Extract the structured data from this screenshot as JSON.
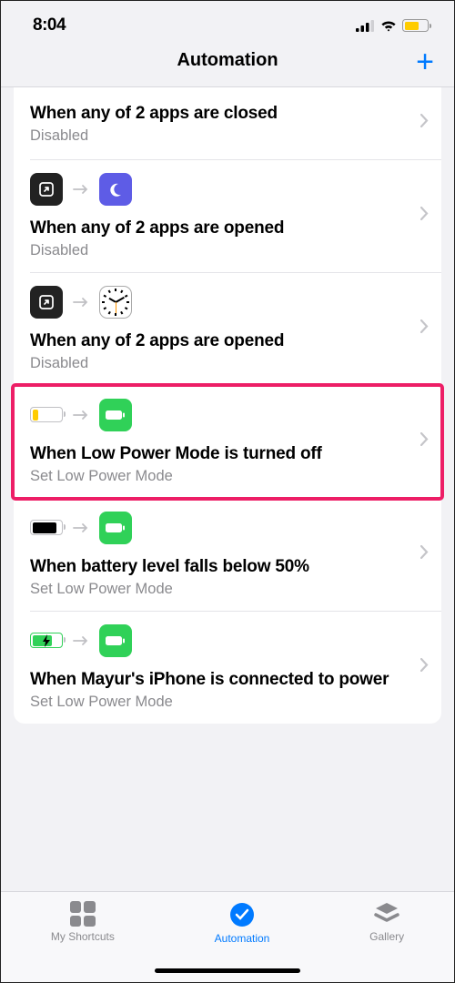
{
  "status": {
    "time": "8:04"
  },
  "nav": {
    "title": "Automation"
  },
  "items": [
    {
      "title": "When any of 2 apps are closed",
      "sub": "Disabled"
    },
    {
      "title": "When any of 2 apps are opened",
      "sub": "Disabled"
    },
    {
      "title": "When any of 2 apps are opened",
      "sub": "Disabled"
    },
    {
      "title": "When Low Power Mode is turned off",
      "sub": "Set Low Power Mode"
    },
    {
      "title": "When battery level falls below 50%",
      "sub": "Set Low Power Mode"
    },
    {
      "title": "When Mayur's iPhone is connected to power",
      "sub": "Set Low Power Mode"
    }
  ],
  "tabs": {
    "shortcuts": "My Shortcuts",
    "automation": "Automation",
    "gallery": "Gallery"
  }
}
